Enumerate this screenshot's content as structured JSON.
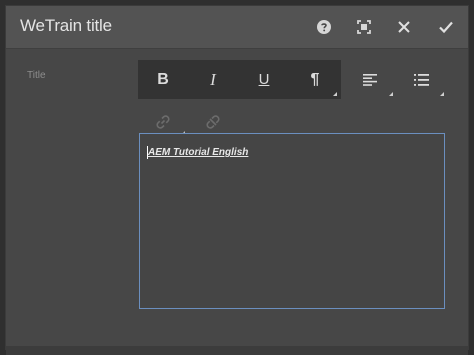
{
  "dialog": {
    "title": "WeTrain title",
    "buttons": [
      "help-icon",
      "fullscreen-icon",
      "close-icon",
      "done-icon"
    ]
  },
  "field": {
    "label": "Title"
  },
  "toolbar": {
    "format": [
      "B",
      "I",
      "U",
      "¶"
    ],
    "align_icon": "align-left-icon",
    "list_icon": "list-icon",
    "link_icon": "link-icon",
    "unlink_icon": "unlink-icon"
  },
  "editor": {
    "text": "AEM Tutorial English"
  },
  "colors": {
    "focus_border": "#6b8fbf",
    "dialog_bg": "#474747",
    "titlebar_bg": "#535353"
  }
}
